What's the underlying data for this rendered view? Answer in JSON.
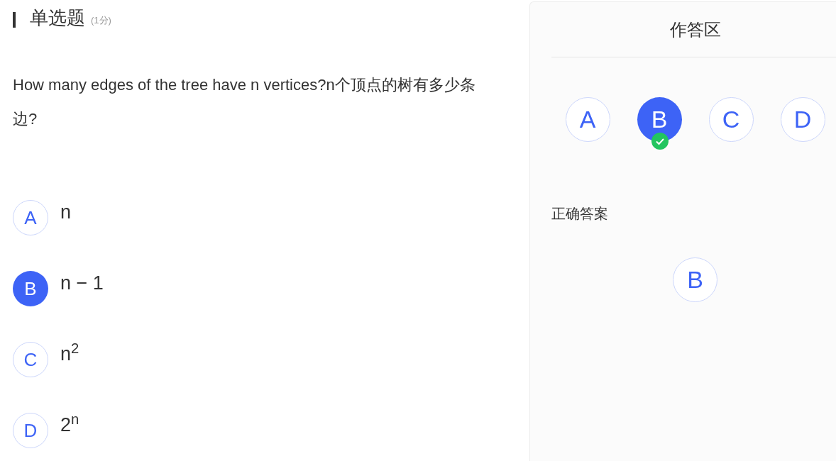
{
  "question": {
    "type": "单选题",
    "score": "(1分)",
    "text": "How many edges of the tree have n vertices?n个顶点的树有多少条边?",
    "options": [
      {
        "letter": "A",
        "text": "n",
        "selected": false
      },
      {
        "letter": "B",
        "text": "n − 1",
        "selected": true
      },
      {
        "letter": "C",
        "text": "n$^{2}$",
        "selected": false
      },
      {
        "letter": "D",
        "text": "2$^{n}$",
        "selected": false
      }
    ]
  },
  "answer_panel": {
    "title": "作答区",
    "choices": [
      {
        "letter": "A",
        "selected": false
      },
      {
        "letter": "B",
        "selected": true
      },
      {
        "letter": "C",
        "selected": false
      },
      {
        "letter": "D",
        "selected": false
      }
    ],
    "correct_label": "正确答案",
    "correct": [
      "B"
    ]
  }
}
